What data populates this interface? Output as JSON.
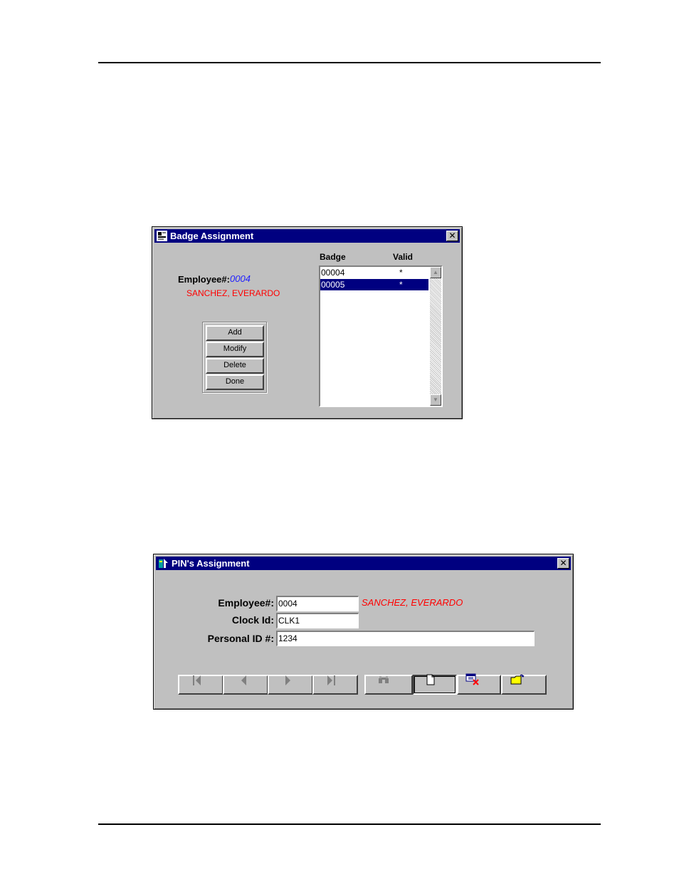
{
  "badge_window": {
    "title": "Badge Assignment",
    "close_glyph": "✕",
    "icon": "badge-app-icon",
    "employee_label": "Employee#:",
    "employee_number": "0004",
    "employee_name": "SANCHEZ, EVERARDO",
    "buttons": {
      "add": "Add",
      "modify": "Modify",
      "delete": "Delete",
      "done": "Done"
    },
    "list": {
      "headers": {
        "badge": "Badge",
        "valid": "Valid"
      },
      "rows": [
        {
          "badge": "00004",
          "valid": "*",
          "selected": false
        },
        {
          "badge": "00005",
          "valid": "*",
          "selected": true
        }
      ]
    }
  },
  "pin_window": {
    "title": "PIN's Assignment",
    "close_glyph": "✕",
    "icon": "pin-app-icon",
    "employee_label": "Employee#:",
    "employee_value": "0004",
    "employee_name": "SANCHEZ, EVERARDO",
    "clock_label": "Clock Id:",
    "clock_value": "CLK1",
    "pid_label": "Personal ID #:",
    "pid_value": "1234",
    "toolbar": [
      "first-record-icon",
      "previous-record-icon",
      "next-record-icon",
      "last-record-icon",
      "find-binoculars-icon",
      "new-document-icon",
      "delete-record-icon",
      "open-folder-icon"
    ]
  },
  "colors": {
    "titlebar": "#000080",
    "window_face": "#c0c0c0",
    "name_red": "#ff0000",
    "number_blue": "#1f1fff",
    "selection": "#000080"
  }
}
